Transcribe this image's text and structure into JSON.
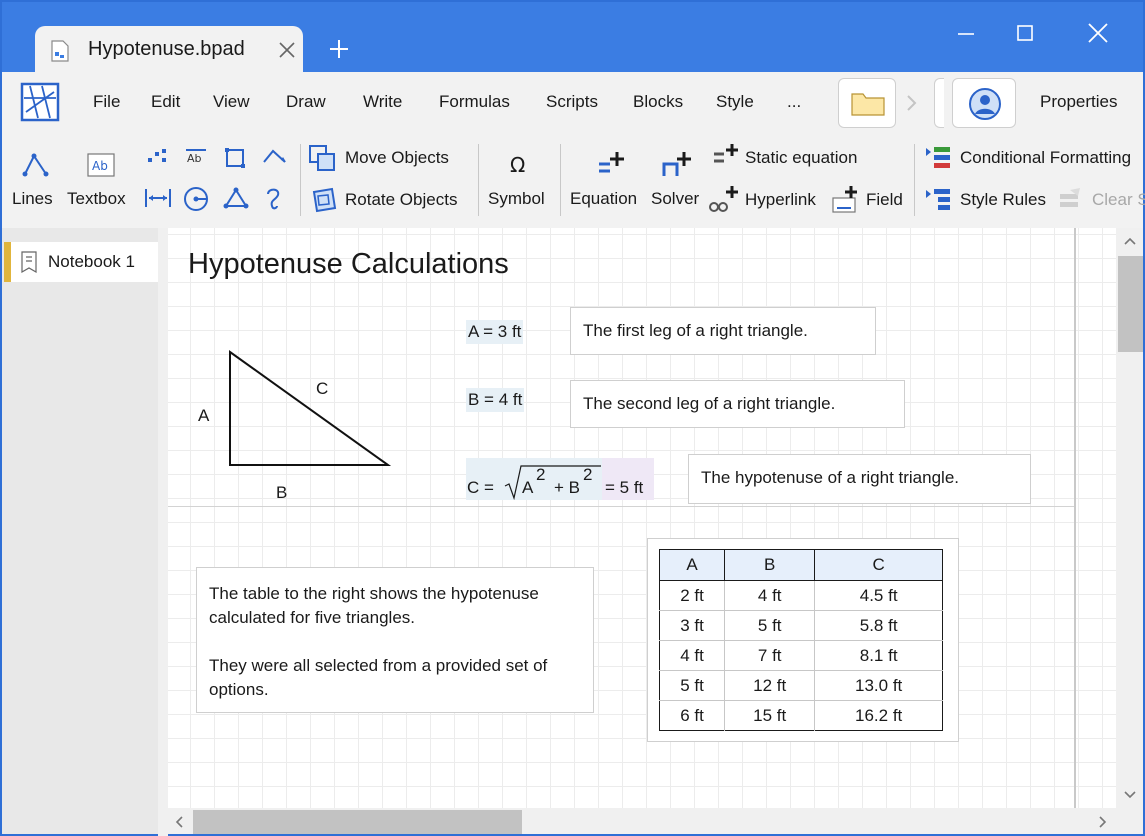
{
  "window": {
    "tab_title": "Hypotenuse.bpad"
  },
  "menu": {
    "items": [
      "File",
      "Edit",
      "View",
      "Draw",
      "Write",
      "Formulas",
      "Scripts",
      "Blocks",
      "Style",
      "..."
    ],
    "properties": "Properties"
  },
  "ribbon": {
    "lines": "Lines",
    "textbox": "Textbox",
    "move_objects": "Move Objects",
    "rotate_objects": "Rotate Objects",
    "symbol": "Symbol",
    "equation": "Equation",
    "solver": "Solver",
    "static_equation": "Static equation",
    "hyperlink": "Hyperlink",
    "field": "Field",
    "conditional_formatting": "Conditional Formatting",
    "style_rules": "Style Rules",
    "clear_style": "Clear S"
  },
  "sidebar": {
    "notebook": "Notebook 1"
  },
  "document": {
    "title": "Hypotenuse Calculations",
    "triangle": {
      "a": "A",
      "b": "B",
      "c": "C"
    },
    "eq_a": "A = 3 ft",
    "eq_b": "B = 4 ft",
    "eq_c": {
      "lhs": "C =",
      "a": "A",
      "exp1": "2",
      "plus": "+ B",
      "exp2": "2",
      "result": "= 5 ft"
    },
    "desc_a": "The first leg of a right triangle.",
    "desc_b": "The second leg of a right triangle.",
    "desc_c": "The hypotenuse of a right triangle.",
    "note_p1": "The table to the right shows the hypotenuse calculated for five triangles.",
    "note_p2": "They were all selected from a provided set of options.",
    "table": {
      "headers": [
        "A",
        "B",
        "C"
      ],
      "rows": [
        [
          "2 ft",
          "4 ft",
          "4.5 ft"
        ],
        [
          "3 ft",
          "5 ft",
          "5.8 ft"
        ],
        [
          "4 ft",
          "7 ft",
          "8.1 ft"
        ],
        [
          "5 ft",
          "12 ft",
          "13.0 ft"
        ],
        [
          "6 ft",
          "15 ft",
          "16.2 ft"
        ]
      ]
    }
  },
  "colors": {
    "titlebar": "#3b7de3",
    "accent_blue": "#2b63c9",
    "notebook_marker": "#e1b53c",
    "equation_highlight": "#e7f0f6",
    "result_highlight": "#efe8f6"
  }
}
